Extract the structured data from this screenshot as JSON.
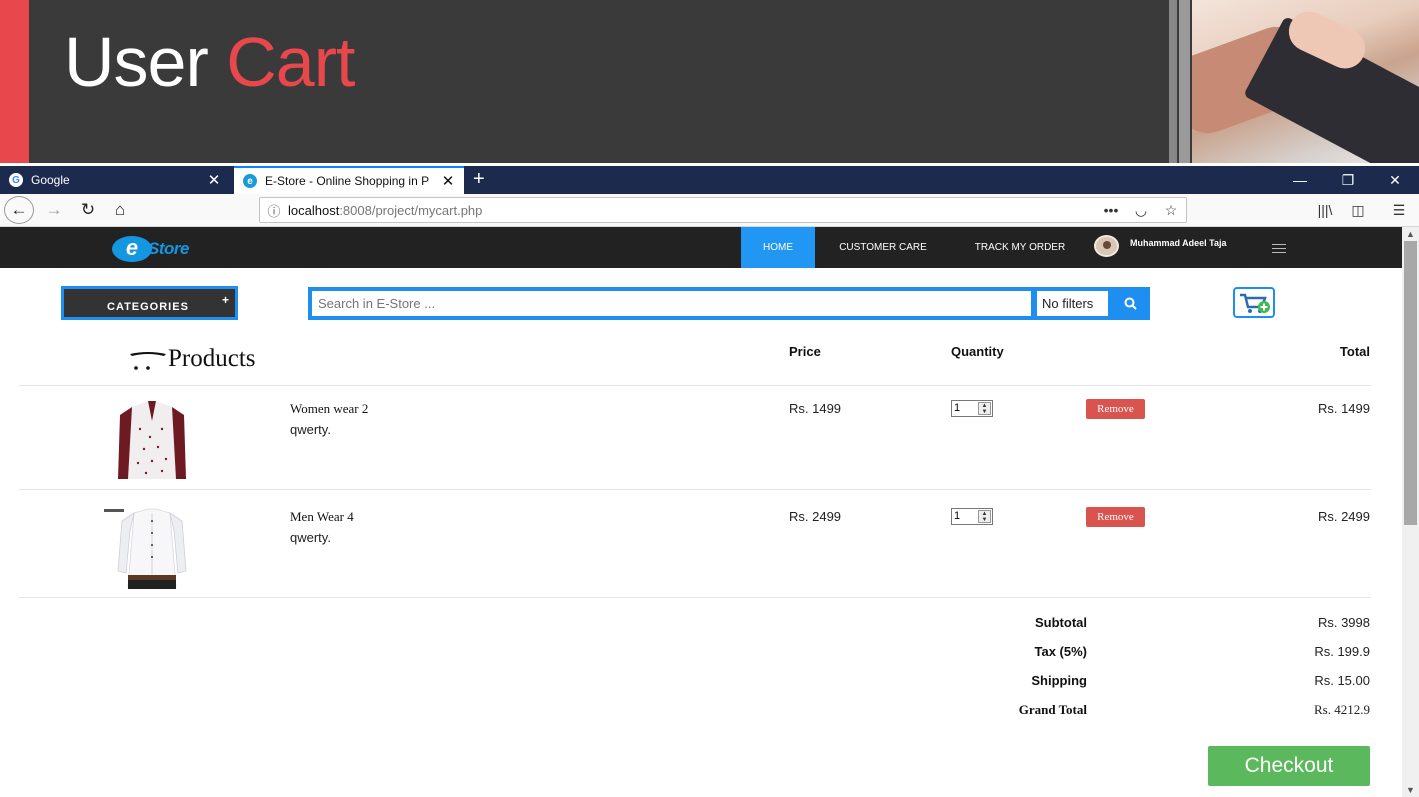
{
  "banner": {
    "title_prefix": "User",
    "title_highlight": "Cart"
  },
  "browser": {
    "tabs": [
      {
        "label": "Google",
        "favicon": "G"
      },
      {
        "label": "E-Store - Online Shopping in P",
        "favicon": "e"
      }
    ],
    "new_tab": "+",
    "url_host": "localhost",
    "url_rest": ":8008/project/mycart.php",
    "page_actions": "•••",
    "window_controls": {
      "minimize": "—",
      "restore": "❐",
      "close": "✕"
    }
  },
  "site": {
    "logo": {
      "mark": "e",
      "word": "Store"
    },
    "menu": {
      "home": "HOME",
      "customer_care": "CUSTOMER CARE",
      "track_order": "TRACK MY ORDER"
    },
    "user_name": "Muhammad Adeel Taja",
    "categories_label": "CATEGORIES",
    "categories_plus": "+",
    "search_placeholder": "Search in E-Store ...",
    "filter_label": "No filters"
  },
  "cart": {
    "headers": {
      "products": "Products",
      "price": "Price",
      "quantity": "Quantity",
      "total": "Total"
    },
    "items": [
      {
        "name": "Women wear 2",
        "desc": "qwerty.",
        "price": "Rs. 1499",
        "qty": "1",
        "remove": "Remove",
        "total": "Rs. 1499",
        "image": "women-shirt-image"
      },
      {
        "name": "Men Wear 4",
        "desc": "qwerty.",
        "price": "Rs. 2499",
        "qty": "1",
        "remove": "Remove",
        "total": "Rs. 2499",
        "image": "men-shirt-image"
      }
    ],
    "summary": {
      "subtotal_label": "Subtotal",
      "subtotal": "Rs. 3998",
      "tax_label": "Tax (5%)",
      "tax": "Rs. 199.9",
      "shipping_label": "Shipping",
      "shipping": "Rs. 15.00",
      "grand_label": "Grand Total",
      "grand": "Rs. 4212.9"
    },
    "checkout_label": "Checkout"
  },
  "colors": {
    "accent_red": "#e8474c",
    "primary_blue": "#2196f3",
    "success_green": "#5cb85c",
    "danger_red": "#d9534f"
  }
}
